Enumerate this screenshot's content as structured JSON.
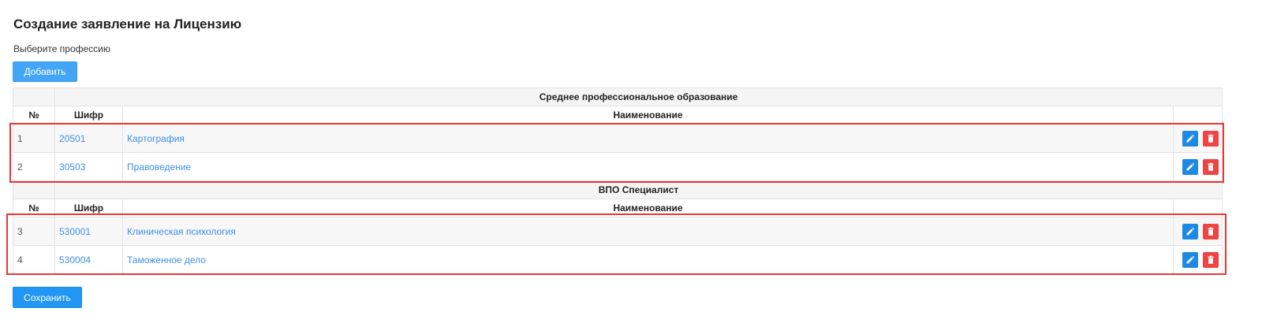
{
  "page": {
    "title": "Создание заявление на Лицензию",
    "subtitle": "Выберите профессию",
    "add_label": "Добавить",
    "save_label": "Сохранить"
  },
  "columns": {
    "num": "№",
    "code": "Шифр",
    "name": "Наименование"
  },
  "groups": [
    {
      "title": "Среднее профессиональное образование",
      "rows": [
        {
          "num": "1",
          "code": "20501",
          "name": "Картография"
        },
        {
          "num": "2",
          "code": "30503",
          "name": "Правоведение"
        }
      ]
    },
    {
      "title": "ВПО Специалист",
      "rows": [
        {
          "num": "3",
          "code": "530001",
          "name": "Клиническая психология"
        },
        {
          "num": "4",
          "code": "530004",
          "name": "Таможенное дело"
        }
      ]
    }
  ],
  "icons": {
    "edit": "pencil-icon",
    "delete": "trash-icon"
  },
  "colors": {
    "primary": "#2196f3",
    "link": "#3f8fe6",
    "edit": "#1e88e5",
    "delete": "#ef4444",
    "highlight": "#e53935"
  }
}
